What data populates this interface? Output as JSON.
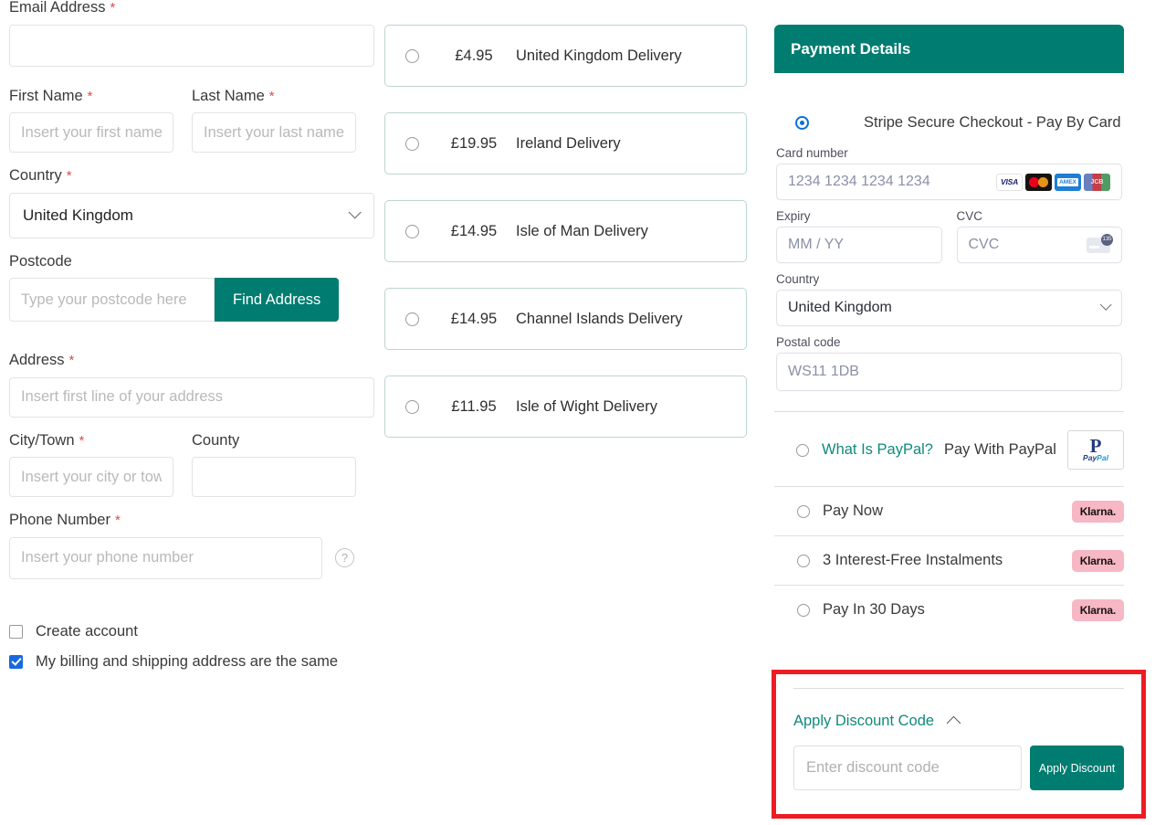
{
  "colors": {
    "teal": "#007c70",
    "teal_link": "#0f8a7d",
    "required_red": "#e04a4a",
    "highlight_red": "#ed1b24",
    "checkbox_blue": "#1769e0",
    "klarna_pink": "#f7b7c5"
  },
  "customer_form": {
    "email": {
      "label": "Email Address",
      "required": "*",
      "value": "",
      "placeholder": ""
    },
    "first_name": {
      "label": "First Name",
      "required": "*",
      "placeholder": "Insert your first name"
    },
    "last_name": {
      "label": "Last Name",
      "required": "*",
      "placeholder": "Insert your last name"
    },
    "country": {
      "label": "Country",
      "required": "*",
      "value": "United Kingdom"
    },
    "postcode": {
      "label": "Postcode",
      "placeholder": "Type your postcode here",
      "button": "Find Address"
    },
    "address": {
      "label": "Address",
      "required": "*",
      "placeholder": "Insert first line of your address"
    },
    "city": {
      "label": "City/Town",
      "required": "*",
      "placeholder": "Insert your city or town"
    },
    "county": {
      "label": "County",
      "placeholder": ""
    },
    "phone": {
      "label": "Phone Number",
      "required": "*",
      "placeholder": "Insert your phone number",
      "help": "?"
    },
    "checkboxes": [
      {
        "label": "Create account",
        "checked": false
      },
      {
        "label": "My billing and shipping address are the same",
        "checked": true
      }
    ]
  },
  "delivery_options": [
    {
      "price": "£4.95",
      "name": "United Kingdom Delivery",
      "selected": false
    },
    {
      "price": "£19.95",
      "name": "Ireland Delivery",
      "selected": false
    },
    {
      "price": "£14.95",
      "name": "Isle of Man Delivery",
      "selected": false
    },
    {
      "price": "£14.95",
      "name": "Channel Islands Delivery",
      "selected": false
    },
    {
      "price": "£11.95",
      "name": "Isle of Wight Delivery",
      "selected": false
    }
  ],
  "payment": {
    "header": "Payment Details",
    "stripe": {
      "title": "Stripe Secure Checkout - Pay By Card",
      "selected": true,
      "card_number": {
        "label": "Card number",
        "placeholder": "1234 1234 1234 1234"
      },
      "expiry": {
        "label": "Expiry",
        "placeholder": "MM / YY"
      },
      "cvc": {
        "label": "CVC",
        "placeholder": "CVC",
        "icon_badge": "135"
      },
      "country": {
        "label": "Country",
        "value": "United Kingdom"
      },
      "postal_code": {
        "label": "Postal code",
        "placeholder": "WS11 1DB"
      },
      "card_brands": [
        "VISA",
        "mastercard",
        "AMEX",
        "JCB"
      ]
    },
    "paypal": {
      "link_text": "What Is PayPal?",
      "label": "Pay With PayPal",
      "logo_mark": "P",
      "logo_pay": "Pay",
      "logo_pal": "Pal",
      "selected": false
    },
    "klarna_options": [
      {
        "label": "Pay Now",
        "badge": "Klarna.",
        "selected": false
      },
      {
        "label": "3 Interest-Free Instalments",
        "badge": "Klarna.",
        "selected": false
      },
      {
        "label": "Pay In 30 Days",
        "badge": "Klarna.",
        "selected": false
      }
    ]
  },
  "discount": {
    "toggle_label": "Apply Discount Code",
    "input_placeholder": "Enter discount code",
    "button_label": "Apply Discount"
  }
}
